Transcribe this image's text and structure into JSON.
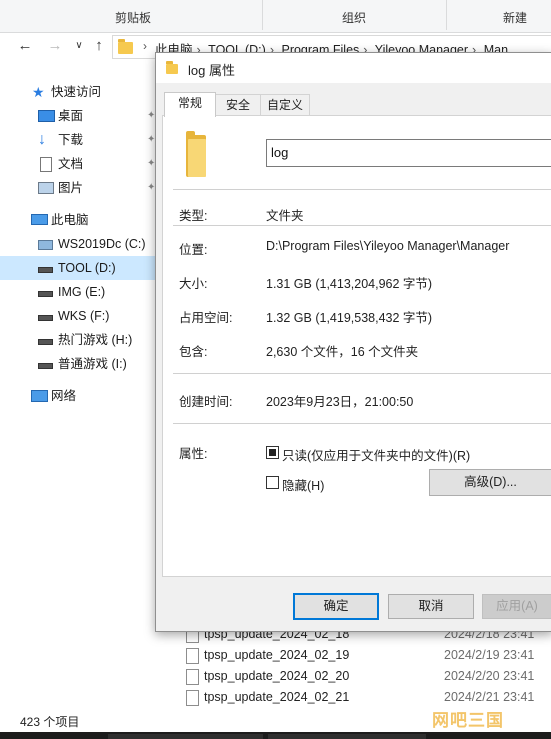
{
  "ribbon": {
    "groups": [
      "剪贴板",
      "组织",
      "新建"
    ]
  },
  "address": {
    "crumbs": [
      "此电脑",
      "TOOL (D:)",
      "Program Files",
      "Yileyoo Manager",
      "Man"
    ]
  },
  "nav_pane": {
    "quick_access": "快速访问",
    "quick_items": [
      {
        "label": "桌面",
        "icon": "desktop-icon"
      },
      {
        "label": "下载",
        "icon": "download-icon"
      },
      {
        "label": "文档",
        "icon": "document-icon"
      },
      {
        "label": "图片",
        "icon": "pictures-icon"
      }
    ],
    "this_pc": "此电脑",
    "drives": [
      {
        "label": "WS2019Dc (C:)"
      },
      {
        "label": "TOOL (D:)",
        "selected": true
      },
      {
        "label": "IMG (E:)"
      },
      {
        "label": "WKS (F:)"
      },
      {
        "label": "热门游戏 (H:)"
      },
      {
        "label": "普通游戏 (I:)"
      }
    ],
    "network": "网络"
  },
  "files": [
    {
      "name": "tpsp_update_2024_02_18",
      "date": "2024/2/18 23:41"
    },
    {
      "name": "tpsp_update_2024_02_19",
      "date": "2024/2/19 23:41"
    },
    {
      "name": "tpsp_update_2024_02_20",
      "date": "2024/2/20 23:41"
    },
    {
      "name": "tpsp_update_2024_02_21",
      "date": "2024/2/21 23:41"
    }
  ],
  "status": {
    "item_count": "423 个项目"
  },
  "dialog": {
    "title": "log 属性",
    "tabs": [
      "常规",
      "安全",
      "自定义"
    ],
    "name_value": "log",
    "type_label": "类型:",
    "type_value": "文件夹",
    "location_label": "位置:",
    "location_value": "D:\\Program Files\\Yileyoo Manager\\Manager",
    "size_label": "大小:",
    "size_value": "1.31 GB (1,413,204,962 字节)",
    "disk_label": "占用空间:",
    "disk_value": "1.32 GB (1,419,538,432 字节)",
    "contains_label": "包含:",
    "contains_value": "2,630 个文件，16 个文件夹",
    "created_label": "创建时间:",
    "created_value": "2023年9月23日，21:00:50",
    "attributes_label": "属性:",
    "readonly_label": "只读(仅应用于文件夹中的文件)(R)",
    "readonly_checked": true,
    "hidden_label": "隐藏(H)",
    "hidden_checked": false,
    "advanced_button": "高级(D)...",
    "ok_button": "确定",
    "cancel_button": "取消",
    "apply_button": "应用(A)"
  },
  "watermark": "网吧三国"
}
